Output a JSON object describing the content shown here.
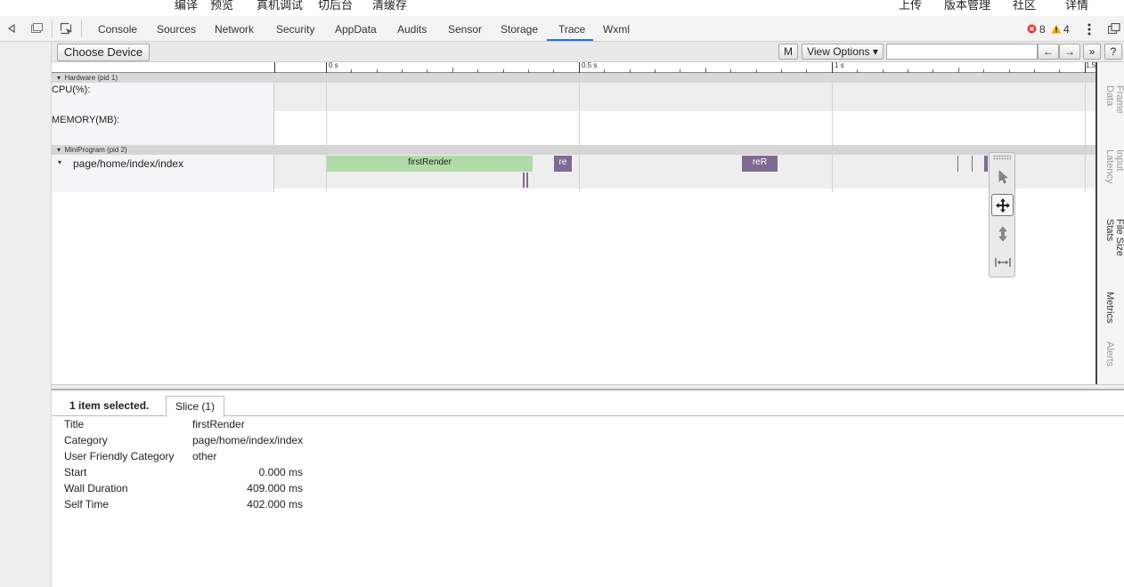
{
  "top_toolbar": {
    "left_items": [
      "编译",
      "预览",
      "真机调试",
      "切后台",
      "清缓存"
    ],
    "right_items": [
      "上传",
      "版本管理",
      "社区",
      "详情"
    ]
  },
  "devtools": {
    "tabs": [
      "Console",
      "Sources",
      "Network",
      "Security",
      "AppData",
      "Audits",
      "Sensor",
      "Storage",
      "Trace",
      "Wxml"
    ],
    "active_tab": "Trace",
    "error_count": "8",
    "warning_count": "4",
    "colors": {
      "error": "#e53935",
      "warning": "#f0b400",
      "active_underline": "#1a73e8"
    }
  },
  "trace_toolbar": {
    "choose_device": "Choose Device",
    "m_button": "M",
    "view_options": "View Options ▾",
    "search_value": "",
    "prev_button": "←",
    "next_button": "→",
    "more_button": "»",
    "help_button": "?"
  },
  "ruler": {
    "ticks": [
      "0 s",
      "0.5 s",
      "1 s",
      "1.5"
    ]
  },
  "tracks": {
    "hardware_header": "Hardware (pid 1)",
    "cpu_label": "CPU(%):",
    "memory_label": "MEMORY(MB):",
    "mini_header": "MiniProgram (pid 2)",
    "page_label": "page/home/index/index",
    "slices": [
      {
        "label": "firstRender",
        "color": "#b0dba8"
      },
      {
        "label": "re",
        "color": "#7e6a93"
      },
      {
        "label": "reR",
        "color": "#7e6a93"
      }
    ]
  },
  "side_panel": {
    "tabs": [
      "Frame\nData",
      "Input\nLatency",
      "File Size\nStats",
      "Metrics",
      "Alerts"
    ]
  },
  "tool_palette": {
    "tools": [
      "select-icon",
      "pan-icon",
      "zoom-icon",
      "timing-icon"
    ]
  },
  "analysis": {
    "selected_text": "1 item selected.",
    "tab_label": "Slice (1)",
    "rows": [
      {
        "label": "Title",
        "value": "firstRender"
      },
      {
        "label": "Category",
        "value": "page/home/index/index"
      },
      {
        "label": "User Friendly Category",
        "value": "other"
      },
      {
        "label": "Start",
        "value": "0.000 ms"
      },
      {
        "label": "Wall Duration",
        "value": "409.000 ms"
      },
      {
        "label": "Self Time",
        "value": "402.000 ms"
      }
    ]
  }
}
